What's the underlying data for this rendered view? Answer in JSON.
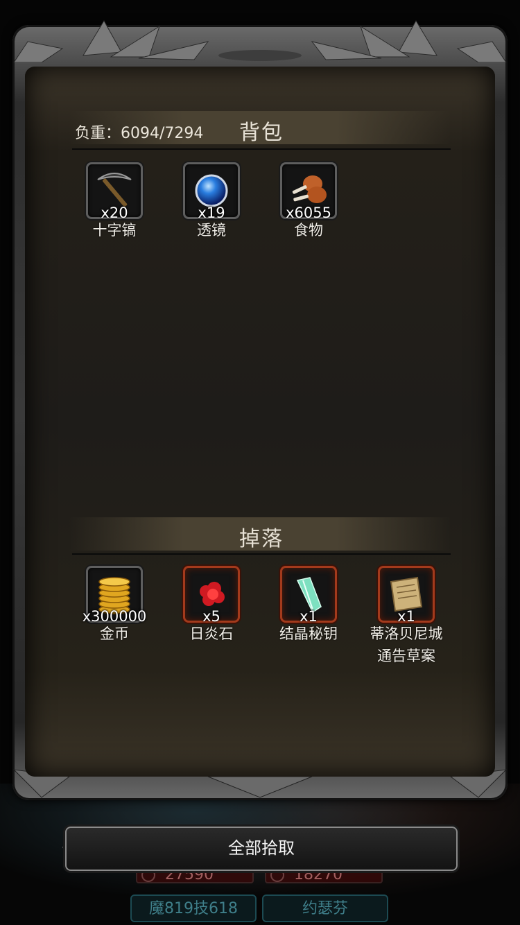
{
  "inventory": {
    "title": "背包",
    "weight_label": "负重：6094/7294",
    "items": [
      {
        "name": "十字镐",
        "qty": "x20",
        "icon": "pickaxe-icon"
      },
      {
        "name": "透镜",
        "qty": "x19",
        "icon": "lens-orb-icon"
      },
      {
        "name": "食物",
        "qty": "x6055",
        "icon": "meat-icon"
      }
    ]
  },
  "drops": {
    "title": "掉落",
    "items": [
      {
        "name": "金币",
        "qty": "x300000",
        "icon": "gold-coins-icon",
        "rarity": "normal"
      },
      {
        "name": "日炎石",
        "qty": "x5",
        "icon": "red-ore-icon",
        "rarity": "rare"
      },
      {
        "name": "结晶秘钥",
        "qty": "x1",
        "icon": "crystal-key-icon",
        "rarity": "rare"
      },
      {
        "name": "蒂洛贝尼城通告草案",
        "name_line1": "蒂洛贝尼城",
        "name_line2": "通告草案",
        "qty": "x1",
        "icon": "parchment-icon",
        "rarity": "rare"
      }
    ]
  },
  "actions": {
    "pickup_all_label": "全部拾取"
  },
  "background_heroes": [
    {
      "hp": "27590",
      "name": "魔819技618"
    },
    {
      "hp": "18270",
      "name": "约瑟芬"
    }
  ],
  "colors": {
    "rare_border": "#a33a1c",
    "normal_border": "#5e5e5e",
    "panel": "#1e1c19",
    "accent_name": "#3f7f8a"
  }
}
